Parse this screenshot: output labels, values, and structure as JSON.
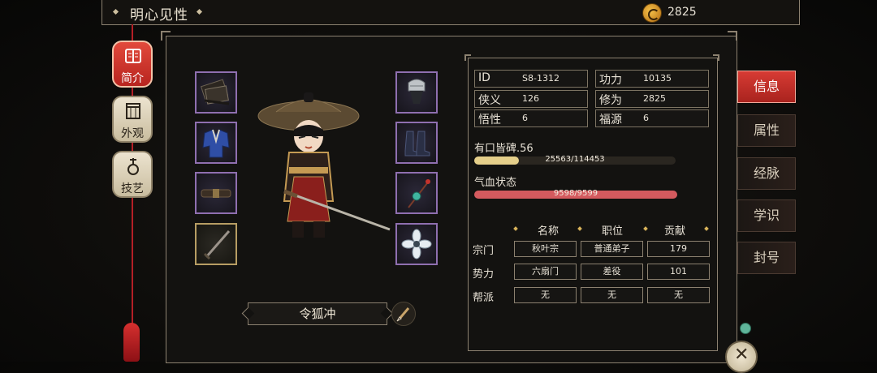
{
  "header": {
    "title": "明心见性",
    "currency_value": "2825"
  },
  "left_nav": [
    {
      "label": "简介",
      "active": true
    },
    {
      "label": "外观",
      "active": false
    },
    {
      "label": "技艺",
      "active": false
    }
  ],
  "character": {
    "name": "令狐冲"
  },
  "stats": {
    "id_label": "ID",
    "id_value": "S8-1312",
    "gongli_label": "功力",
    "gongli_value": "10135",
    "xiayi_label": "侠义",
    "xiayi_value": "126",
    "xiuwei_label": "修为",
    "xiuwei_value": "2825",
    "wuxing_label": "悟性",
    "wuxing_value": "6",
    "fuyuan_label": "福源",
    "fuyuan_value": "6"
  },
  "reputation": {
    "label": "有口皆碑.56",
    "text": "25563/114453",
    "fraction": 0.223
  },
  "health": {
    "label": "气血状态",
    "text": "9598/9599",
    "fraction": 0.9999
  },
  "affiliation": {
    "headers": [
      "名称",
      "职位",
      "贡献"
    ],
    "rows": [
      {
        "label": "宗门",
        "cells": [
          "秋叶宗",
          "普通弟子",
          "179"
        ]
      },
      {
        "label": "势力",
        "cells": [
          "六扇门",
          "差役",
          "101"
        ]
      },
      {
        "label": "帮派",
        "cells": [
          "无",
          "无",
          "无"
        ]
      }
    ]
  },
  "right_tabs": [
    {
      "label": "信息",
      "active": true
    },
    {
      "label": "属性",
      "active": false
    },
    {
      "label": "经脉",
      "active": false
    },
    {
      "label": "学识",
      "active": false
    },
    {
      "label": "封号",
      "active": false
    }
  ],
  "colors": {
    "accent_red": "#d73b34",
    "rep_bar": "#e5cf8a",
    "hp_bar": "#d45a5e",
    "epic_border": "#8f6fb0",
    "gold_border": "#b79d63"
  },
  "icons": [
    "coin-icon",
    "book-icon",
    "portrait-icon",
    "pipa-icon",
    "brush-icon",
    "close-icon"
  ]
}
